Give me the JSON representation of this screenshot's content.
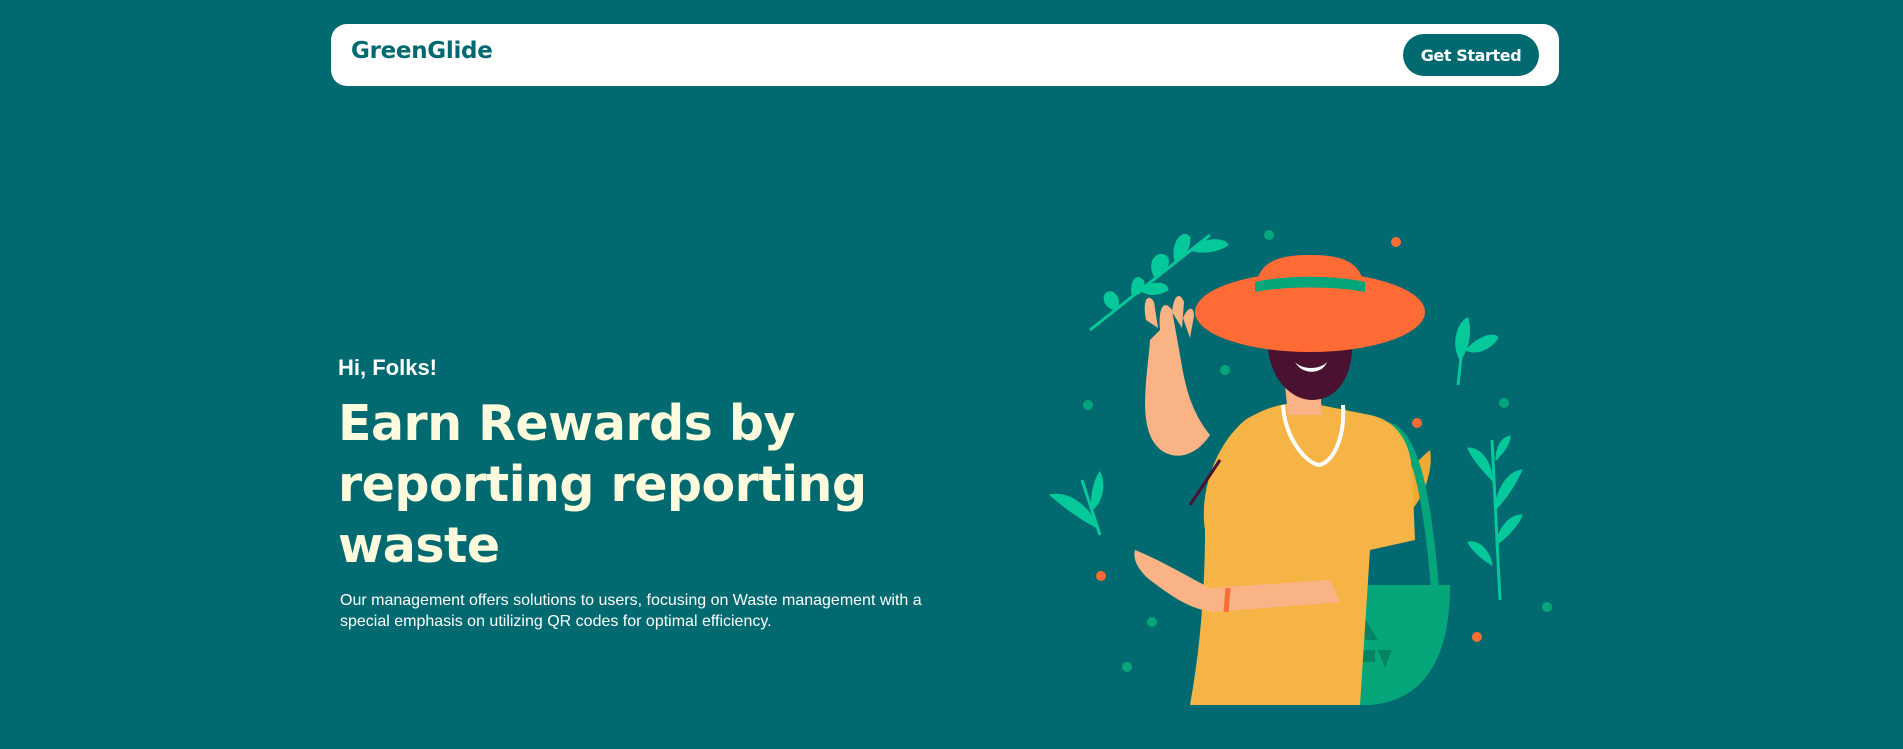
{
  "navbar": {
    "brand": "GreenGlide",
    "cta_label": "Get Started"
  },
  "hero": {
    "greeting": "Hi, Folks!",
    "headline": "Earn Rewards by reporting reporting waste",
    "description": "Our management offers solutions to users, focusing on Waste management with a special emphasis on utilizing QR codes for optimal efficiency."
  },
  "colors": {
    "background": "#016a70",
    "navbar_bg": "#ffffff",
    "brand": "#016a70",
    "headline": "#fffbdc",
    "accent_orange": "#ff6b35",
    "accent_green": "#05a67a",
    "shirt_yellow": "#f5b445"
  },
  "illustration": {
    "subject": "man-waving-with-recycling-bag-illustration",
    "icons": [
      "recycle-icon",
      "leaf-icon"
    ]
  }
}
